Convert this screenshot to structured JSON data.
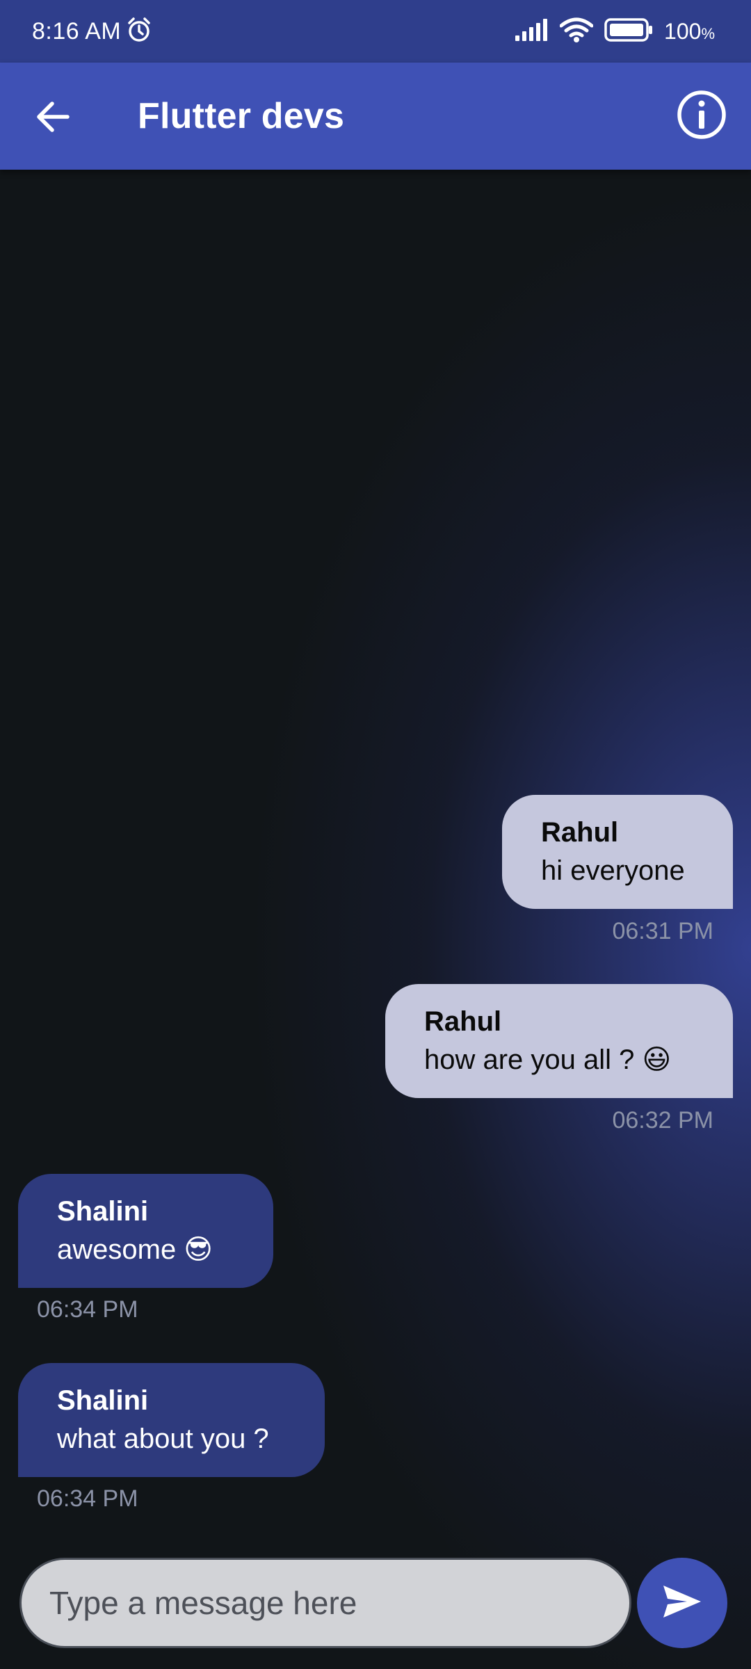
{
  "status_bar": {
    "time": "8:16 AM",
    "battery": "100",
    "battery_unit": "%",
    "icons": [
      "alarm-icon",
      "signal-icon",
      "wifi-icon",
      "battery-icon"
    ]
  },
  "app_bar": {
    "title": "Flutter devs",
    "back_icon": "arrow-left-icon",
    "info_icon": "info-icon",
    "color": "#3f51b5"
  },
  "messages": [
    {
      "sender": "Rahul",
      "text": "hi everyone",
      "time": "06:31 PM",
      "direction": "outgoing"
    },
    {
      "sender": "Rahul",
      "text": "how are you all ? 😃",
      "time": "06:32 PM",
      "direction": "outgoing"
    },
    {
      "sender": "Shalini",
      "text": "awesome 😎",
      "time": "06:34 PM",
      "direction": "incoming"
    },
    {
      "sender": "Shalini",
      "text": "what about you ?",
      "time": "06:34 PM",
      "direction": "incoming"
    }
  ],
  "composer": {
    "placeholder": "Type a message here",
    "value": "",
    "send_icon": "send-icon"
  },
  "colors": {
    "outgoing_bubble": "#c5c7dd",
    "incoming_bubble": "#2e3a7d",
    "accent": "#3f51b5",
    "status_bar": "#2f3e8c"
  }
}
